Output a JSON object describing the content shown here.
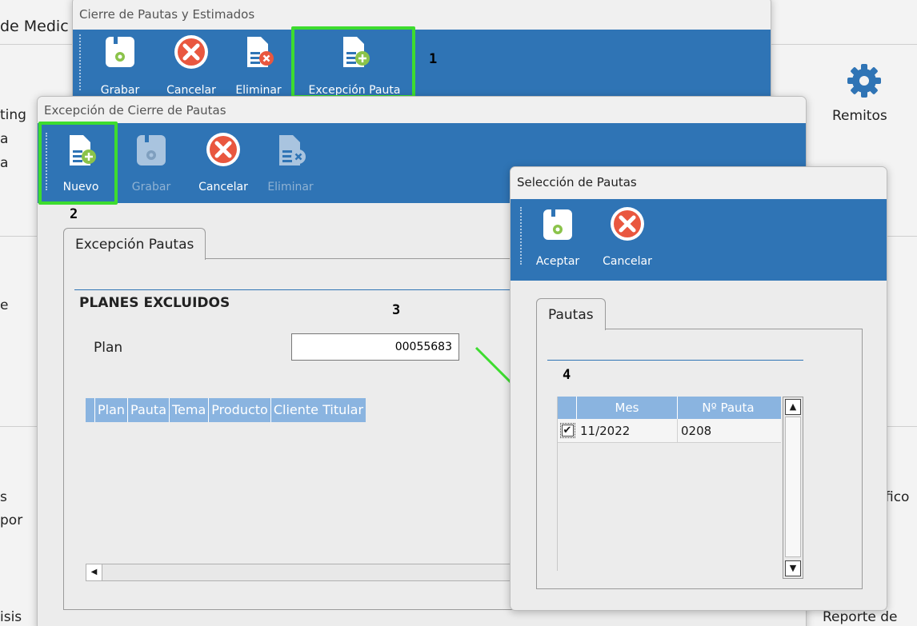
{
  "background": {
    "title_partial": "de Medic",
    "left_texts": [
      "ting",
      "a",
      "a",
      "e",
      "s",
      "por",
      "isis"
    ],
    "right_texts": {
      "remitos": "Remitos",
      "fico": "fico",
      "reporte": "Reporte de"
    }
  },
  "win1": {
    "title": "Cierre de Pautas y Estimados",
    "toolbar": {
      "grabar": "Grabar",
      "cancelar": "Cancelar",
      "eliminar": "Eliminar",
      "excepcion": "Excepción Pauta"
    }
  },
  "win2": {
    "title": "Excepción de Cierre de Pautas",
    "toolbar": {
      "nuevo": "Nuevo",
      "grabar": "Grabar",
      "cancelar": "Cancelar",
      "eliminar": "Eliminar"
    },
    "tab": "Excepción Pautas",
    "section_title": "PLANES EXCLUIDOS",
    "plan_label": "Plan",
    "plan_value": "00055683",
    "grid_columns": [
      "Plan",
      "Pauta",
      "Tema",
      "Producto",
      "Cliente Titular"
    ]
  },
  "win3": {
    "title": "Selección de Pautas",
    "toolbar": {
      "aceptar": "Aceptar",
      "cancelar": "Cancelar"
    },
    "tab": "Pautas",
    "grid_columns": [
      "Mes",
      "Nº Pauta"
    ],
    "rows": [
      {
        "checked": true,
        "mes": "11/2022",
        "pauta": "0208"
      }
    ]
  },
  "annotations": {
    "n1": "1",
    "n2": "2",
    "n3": "3",
    "n4": "4"
  },
  "colors": {
    "toolbar": "#2f74b5",
    "highlight": "#3ddc2f",
    "grid_header": "#8ab4e0"
  }
}
